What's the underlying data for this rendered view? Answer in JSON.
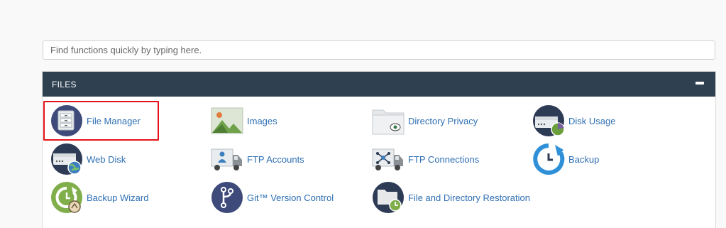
{
  "search": {
    "placeholder": "Find functions quickly by typing here."
  },
  "section": {
    "title": "FILES",
    "items": [
      {
        "label": "File Manager",
        "icon": "file-manager-icon"
      },
      {
        "label": "Images",
        "icon": "images-icon"
      },
      {
        "label": "Directory Privacy",
        "icon": "directory-privacy-icon"
      },
      {
        "label": "Disk Usage",
        "icon": "disk-usage-icon"
      },
      {
        "label": "Web Disk",
        "icon": "web-disk-icon"
      },
      {
        "label": "FTP Accounts",
        "icon": "ftp-accounts-icon"
      },
      {
        "label": "FTP Connections",
        "icon": "ftp-connections-icon"
      },
      {
        "label": "Backup",
        "icon": "backup-icon"
      },
      {
        "label": "Backup Wizard",
        "icon": "backup-wizard-icon"
      },
      {
        "label": "Git™ Version Control",
        "icon": "git-version-control-icon"
      },
      {
        "label": "File and Directory Restoration",
        "icon": "file-directory-restoration-icon"
      }
    ]
  },
  "colors": {
    "header": "#2f4051",
    "link": "#2e6fb3",
    "highlight": "#e3131a"
  }
}
